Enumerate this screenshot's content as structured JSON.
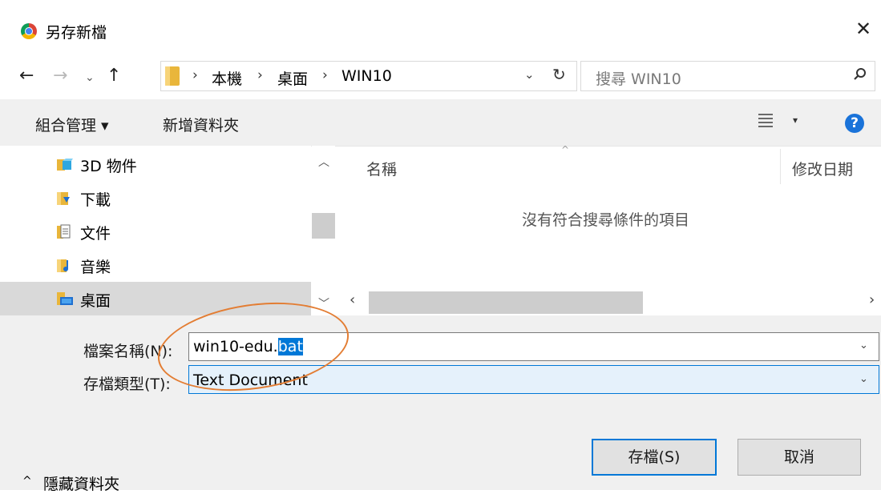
{
  "window": {
    "title": "另存新檔",
    "close_glyph": "✕"
  },
  "nav": {
    "back": "←",
    "forward": "→",
    "recent": "⌄",
    "up": "↑"
  },
  "address": {
    "breadcrumbs": [
      "本機",
      "桌面",
      "WIN10"
    ],
    "separator": "›",
    "dropdown": "⌄",
    "refresh": "↻"
  },
  "search": {
    "placeholder": "搜尋 WIN10"
  },
  "command_bar": {
    "organize": "組合管理 ▾",
    "new_folder": "新增資料夾",
    "view_dropdown": "▾",
    "help": "?"
  },
  "tree": {
    "items": [
      {
        "label": "3D 物件",
        "icon": "3d-objects-icon"
      },
      {
        "label": "下載",
        "icon": "downloads-icon"
      },
      {
        "label": "文件",
        "icon": "documents-icon"
      },
      {
        "label": "音樂",
        "icon": "music-icon"
      },
      {
        "label": "桌面",
        "icon": "desktop-icon",
        "selected": true
      }
    ]
  },
  "list": {
    "columns": [
      "名稱",
      "修改日期"
    ],
    "sort_glyph": "^",
    "empty_message": "沒有符合搜尋條件的項目"
  },
  "form": {
    "filename_label": "檔案名稱(N):",
    "filename_value_prefix": "win10-edu.",
    "filename_value_selected": "bat",
    "filetype_label": "存檔類型(T):",
    "filetype_value": "Text Document",
    "chevron": "⌄"
  },
  "footer": {
    "hide_folders": "隱藏資料夾",
    "hide_chevron": "^",
    "save": "存檔(S)",
    "cancel": "取消"
  },
  "colors": {
    "accent": "#0078d7",
    "annotation": "#e37d33",
    "panel_bg": "#f0f0f0"
  }
}
